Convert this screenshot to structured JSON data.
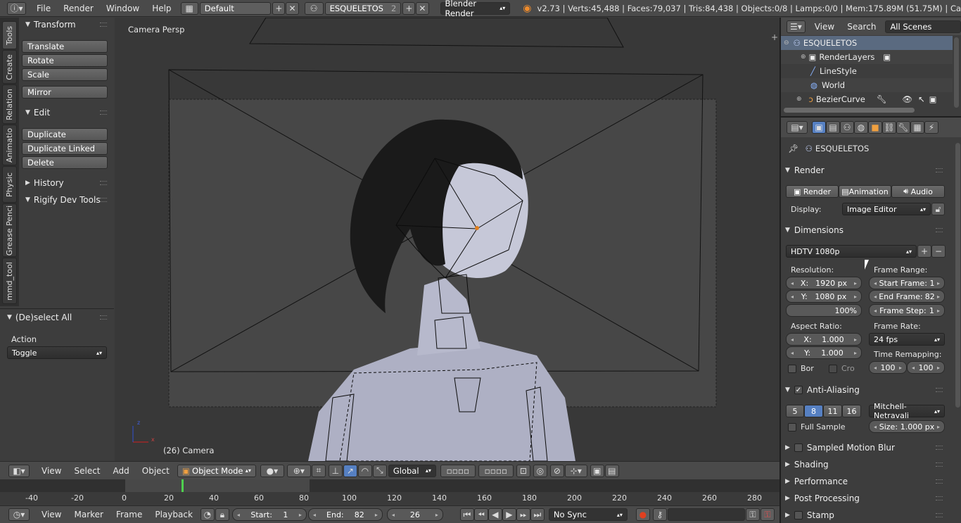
{
  "topbar": {
    "menus": [
      "File",
      "Render",
      "Window",
      "Help"
    ],
    "layout": "Default",
    "scene": "ESQUELETOS",
    "scene_users": "2",
    "engine": "Blender Render",
    "stats": "v2.73 | Verts:45,488 | Faces:79,037 | Tris:84,438 | Objects:0/8 | Lamps:0/0 | Mem:175.89M (51.75M) | Ca"
  },
  "toolshelf": {
    "tabs": [
      "Tools",
      "Create",
      "Relation",
      "Animatio",
      "Physic",
      "Grease Penci",
      "mmd_tool"
    ],
    "transform": {
      "title": "Transform",
      "buttons": [
        "Translate",
        "Rotate",
        "Scale",
        "Mirror"
      ]
    },
    "edit": {
      "title": "Edit",
      "buttons": [
        "Duplicate",
        "Duplicate Linked",
        "Delete"
      ]
    },
    "history": "History",
    "rigify": "Rigify Dev Tools",
    "operator": {
      "title": "(De)select All",
      "action_label": "Action",
      "action_value": "Toggle"
    }
  },
  "viewport": {
    "view_label": "Camera Persp",
    "object_label": "(26) Camera"
  },
  "vp_header": {
    "menus": [
      "View",
      "Select",
      "Add",
      "Object"
    ],
    "mode": "Object Mode",
    "orientation": "Global"
  },
  "timeline": {
    "ticks": [
      "-40",
      "-20",
      "0",
      "20",
      "40",
      "60",
      "80",
      "100",
      "120",
      "140",
      "160",
      "180",
      "200",
      "220",
      "240",
      "260",
      "280"
    ],
    "menus": [
      "View",
      "Marker",
      "Frame",
      "Playback"
    ],
    "start_label": "Start:",
    "start_value": "1",
    "end_label": "End:",
    "end_value": "82",
    "current": "26",
    "sync": "No Sync"
  },
  "outliner": {
    "menus": [
      "View",
      "Search"
    ],
    "scope": "All Scenes",
    "rows": [
      "ESQUELETOS",
      "RenderLayers",
      "LineStyle",
      "World",
      "BezierCurve"
    ]
  },
  "properties": {
    "context": "ESQUELETOS",
    "render": {
      "title": "Render",
      "buttons": [
        "Render",
        "Animation",
        "Audio"
      ],
      "display_label": "Display:",
      "display_value": "Image Editor"
    },
    "dimensions": {
      "title": "Dimensions",
      "preset": "HDTV 1080p",
      "resolution_label": "Resolution:",
      "res_x": "1920 px",
      "res_y": "1080 px",
      "res_pct": "100%",
      "frame_range_label": "Frame Range:",
      "start_frame_label": "Start Frame:",
      "start_frame": "1",
      "end_frame_label": "End Frame:",
      "end_frame": "82",
      "frame_step_label": "Frame Step:",
      "frame_step": "1",
      "aspect_label": "Aspect Ratio:",
      "aspect_x": "1.000",
      "aspect_y": "1.000",
      "frame_rate_label": "Frame Rate:",
      "frame_rate": "24 fps",
      "time_remap_label": "Time Remapping:",
      "remap_old": "100",
      "remap_new": "100",
      "bor": "Bor",
      "cro": "Cro"
    },
    "antialiasing": {
      "title": "Anti-Aliasing",
      "samples": [
        "5",
        "8",
        "11",
        "16"
      ],
      "filter": "Mitchell-Netravali",
      "full_sample": "Full Sample",
      "size_label": "Size:",
      "size_value": "1.000 px"
    },
    "sections": [
      "Sampled Motion Blur",
      "Shading",
      "Performance",
      "Post Processing",
      "Stamp"
    ]
  },
  "colors": {
    "accent": "#5680c2",
    "selected_row": "#5a6a80",
    "frame_marker": "#4fd04f"
  }
}
